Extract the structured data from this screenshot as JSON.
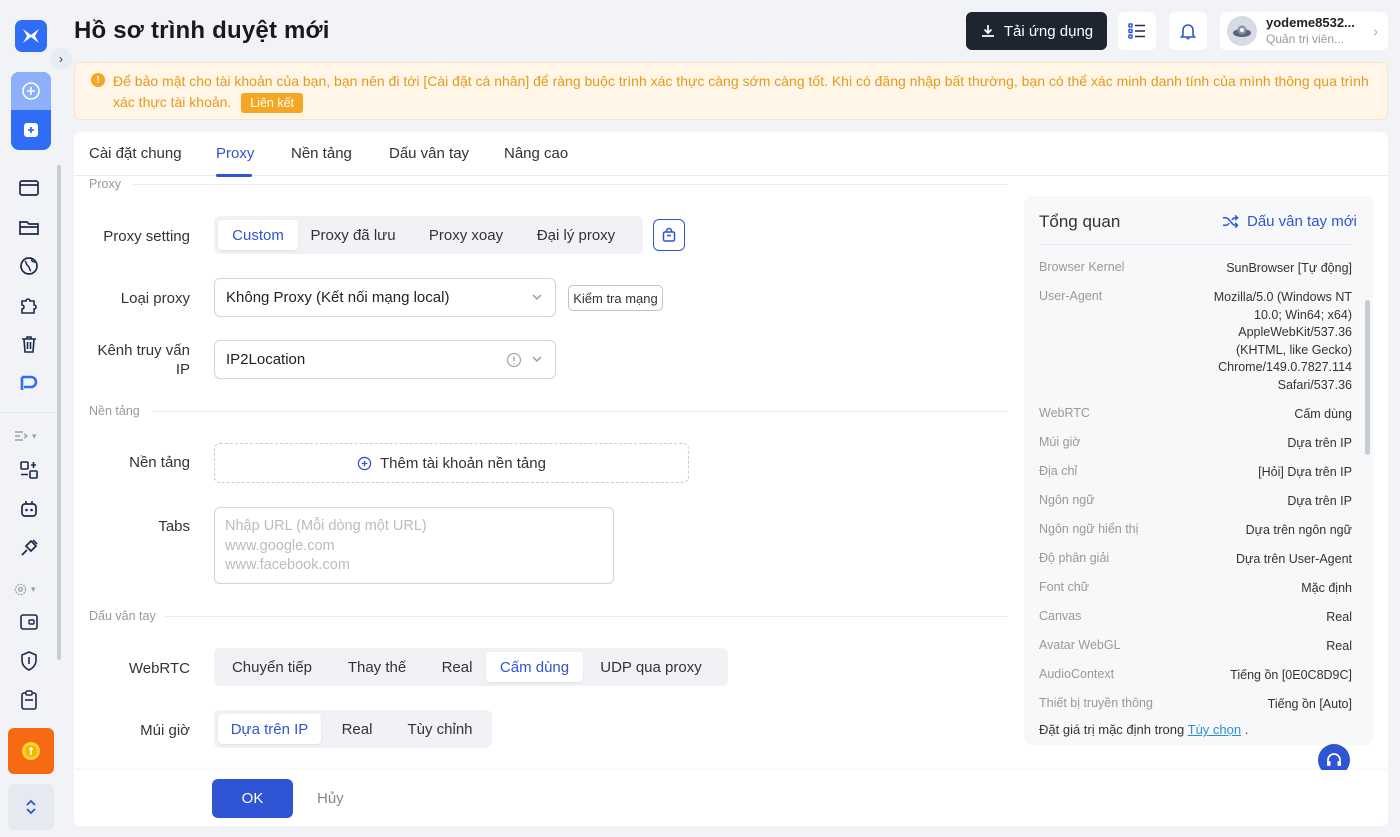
{
  "page": {
    "title": "Hồ sơ trình duyệt mới"
  },
  "header": {
    "download_label": "Tải ứng dụng",
    "user_name": "yodeme8532...",
    "user_role": "Quản trị viên..."
  },
  "banner": {
    "message": "Để bảo mật cho tài khoản của bạn, bạn nên đi tới [Cài đặt cá nhân] để ràng buộc trình xác thực càng sớm càng tốt. Khi có đăng nhập bất thường, bạn có thể xác minh danh tính của mình thông qua trình xác thực tài khoản.",
    "link_label": "Liên kết"
  },
  "tabs": [
    "Cài đặt chung",
    "Proxy",
    "Nền tảng",
    "Dấu vân tay",
    "Nâng cao"
  ],
  "active_tab": "Proxy",
  "proxy": {
    "section_label": "Proxy",
    "setting_label": "Proxy setting",
    "setting_options": [
      "Custom",
      "Proxy đã lưu",
      "Proxy xoay",
      "Đại lý proxy"
    ],
    "setting_selected": "Custom",
    "type_label": "Loại proxy",
    "type_value": "Không Proxy (Kết nối mạng local)",
    "check_network_label": "Kiểm tra mạng",
    "ip_query_label_1": "Kênh truy vấn",
    "ip_query_label_2": "IP",
    "ip_query_value": "IP2Location"
  },
  "platform": {
    "section_label": "Nền tảng",
    "platform_label": "Nền tảng",
    "add_account_label": "Thêm tài khoản nền tảng",
    "tabs_label": "Tabs",
    "tabs_placeholder": [
      "Nhập URL (Mỗi dòng một URL)",
      "www.google.com",
      "www.facebook.com"
    ]
  },
  "fingerprint": {
    "section_label": "Dấu vân tay",
    "webrtc_label": "WebRTC",
    "webrtc_options": [
      "Chuyển tiếp",
      "Thay thế",
      "Real",
      "Cấm dùng",
      "UDP qua proxy"
    ],
    "webrtc_selected": "Cấm dùng",
    "timezone_label": "Múi giờ",
    "timezone_options": [
      "Dựa trên IP",
      "Real",
      "Tùy chỉnh"
    ],
    "timezone_selected": "Dựa trên IP"
  },
  "overview": {
    "title": "Tổng quan",
    "new_fingerprint_label": "Dấu vân tay mới",
    "rows": [
      {
        "key": "Browser Kernel",
        "value": [
          "SunBrowser [Tự động]"
        ]
      },
      {
        "key": "User-Agent",
        "value": [
          "Mozilla/5.0 (Windows NT",
          "10.0; Win64; x64)",
          "AppleWebKit/537.36",
          "(KHTML, like Gecko)",
          "Chrome/149.0.7827.114",
          "Safari/537.36"
        ]
      },
      {
        "key": "WebRTC",
        "value": [
          "Cấm dùng"
        ]
      },
      {
        "key": "Múi giờ",
        "value": [
          "Dựa trên IP"
        ]
      },
      {
        "key": "Địa chỉ",
        "value": [
          "[Hỏi] Dựa trên IP"
        ]
      },
      {
        "key": "Ngôn ngữ",
        "value": [
          "Dựa trên IP"
        ]
      },
      {
        "key": "Ngôn ngữ hiển thị",
        "value": [
          "Dựa trên ngôn ngữ"
        ]
      },
      {
        "key": "Độ phân giải",
        "value": [
          "Dựa trên User-Agent"
        ]
      },
      {
        "key": "Font chữ",
        "value": [
          "Mặc định"
        ]
      },
      {
        "key": "Canvas",
        "value": [
          "Real"
        ]
      },
      {
        "key": "Avatar WebGL",
        "value": [
          "Real"
        ]
      },
      {
        "key": "AudioContext",
        "value": [
          "Tiếng ồn [0E0C8D9C]"
        ]
      },
      {
        "key": "Thiết bị truyền thông",
        "value": [
          "Tiếng ồn [Auto]"
        ]
      }
    ],
    "footer_prefix": "Đặt giá trị mặc định trong",
    "footer_link": "Tùy chọn",
    "footer_suffix": "."
  },
  "footer": {
    "ok_label": "OK",
    "cancel_label": "Hủy"
  },
  "colors": {
    "accent": "#2f55d4",
    "brand": "#2f6df6",
    "warning": "#f5a623",
    "dark_button": "#1e2430"
  }
}
